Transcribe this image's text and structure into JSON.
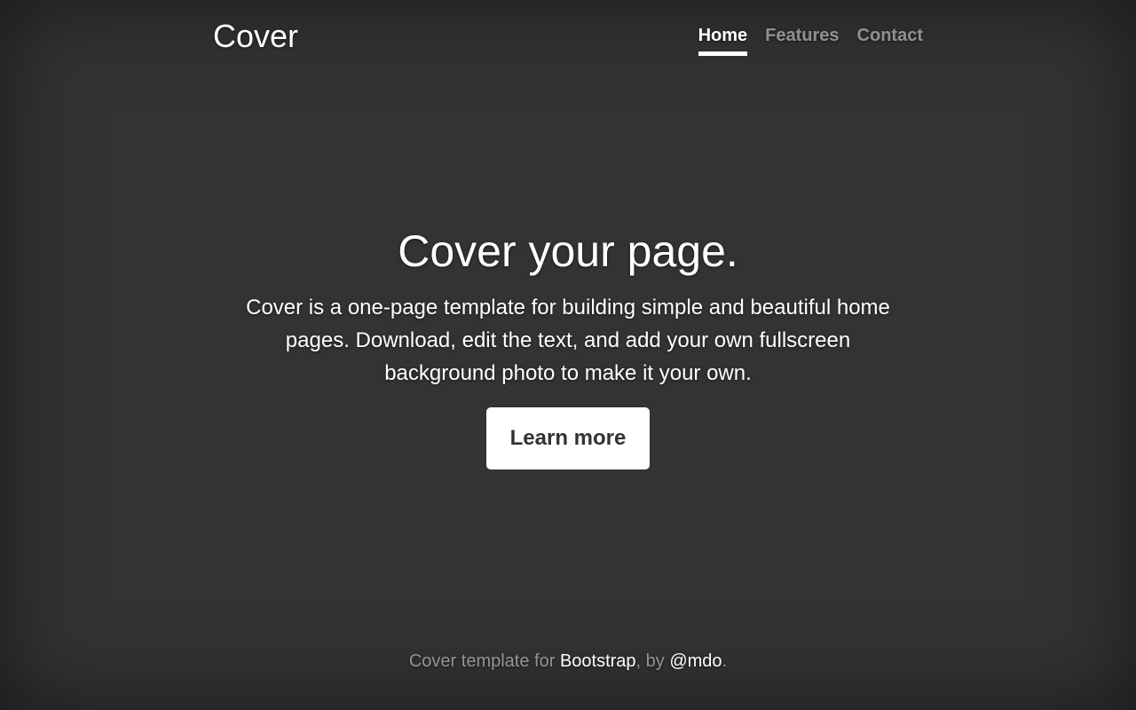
{
  "masthead": {
    "brand": "Cover",
    "nav": [
      {
        "label": "Home",
        "active": true
      },
      {
        "label": "Features",
        "active": false
      },
      {
        "label": "Contact",
        "active": false
      }
    ]
  },
  "cover": {
    "heading": "Cover your page.",
    "lead": "Cover is a one-page template for building simple and beautiful home pages. Download, edit the text, and add your own fullscreen background photo to make it your own.",
    "button_label": "Learn more"
  },
  "footer": {
    "prefix": "Cover template for ",
    "bootstrap_link": "Bootstrap",
    "middle": ", by ",
    "author_link": "@mdo",
    "suffix": "."
  },
  "colors": {
    "background": "#333333",
    "text": "#ffffff",
    "muted_text": "rgba(255,255,255,0.5)",
    "button_background": "#ffffff",
    "button_text": "#333333"
  }
}
